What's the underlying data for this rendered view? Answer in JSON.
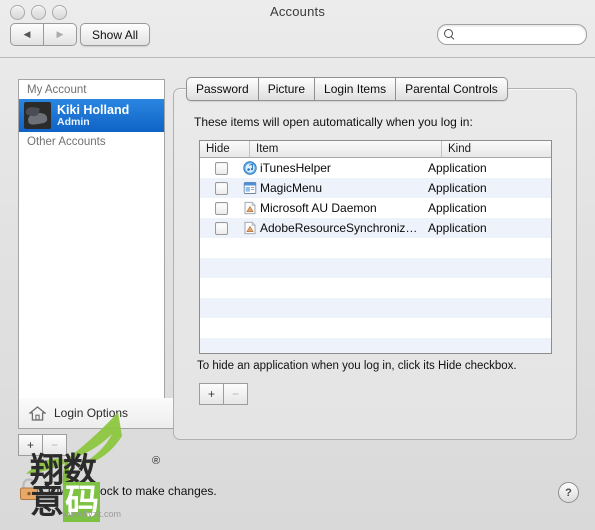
{
  "window": {
    "title": "Accounts",
    "traffic_lights": [
      "close-button",
      "minimize-button",
      "zoom-button"
    ],
    "back_label": "◀",
    "forward_label": "▶",
    "show_all_label": "Show All",
    "help_label": "?"
  },
  "search": {
    "value": "",
    "placeholder": ""
  },
  "sidebar": {
    "group_my_account": "My Account",
    "account": {
      "name": "Kiki Holland",
      "role": "Admin"
    },
    "group_other_accounts": "Other Accounts",
    "login_options_label": "Login Options",
    "add_label": "+",
    "remove_label": "−"
  },
  "tabs": [
    {
      "label": "Password",
      "selected": false
    },
    {
      "label": "Picture",
      "selected": false
    },
    {
      "label": "Login Items",
      "selected": true
    },
    {
      "label": "Parental Controls",
      "selected": false
    }
  ],
  "login_items": {
    "intro": "These items will open automatically when you log in:",
    "columns": [
      "Hide",
      "Item",
      "Kind"
    ],
    "rows": [
      {
        "hide": false,
        "icon": "itunes-icon",
        "item": "iTunesHelper",
        "kind": "Application"
      },
      {
        "hide": false,
        "icon": "magicmenu-icon",
        "item": "MagicMenu",
        "kind": "Application"
      },
      {
        "hide": false,
        "icon": "generic-app-icon",
        "item": "Microsoft AU Daemon",
        "kind": "Application"
      },
      {
        "hide": false,
        "icon": "generic-app-icon",
        "item": "AdobeResourceSynchroniz…",
        "kind": "Application"
      }
    ],
    "hint": "To hide an application when you log in, click its Hide checkbox.",
    "add_label": "+",
    "remove_label": "−"
  },
  "lock": {
    "text": "Click the lock to make changes.",
    "state": "unlocked"
  },
  "watermark": {
    "line1_a": "翔",
    "line1_b": "数",
    "line2_a": "意",
    "line2_b": "码",
    "registered": "®",
    "url": "www.flyzk.com"
  },
  "colors": {
    "selection_blue": "#1a6fd4",
    "row_stripe": "#eef2fa",
    "watermark_green": "#7dc242"
  }
}
